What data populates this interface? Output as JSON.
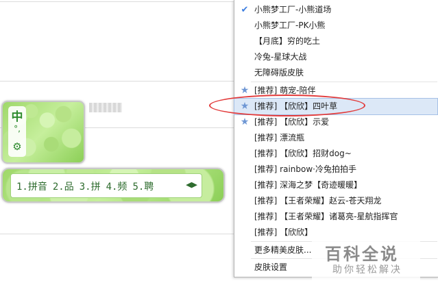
{
  "ime": {
    "mode_char": "中",
    "punct_char": "°,",
    "settings_icon": "gear-icon"
  },
  "candidates": {
    "items": [
      "1.拼音",
      "2.品",
      "3.拼",
      "4.频",
      "5.聘"
    ],
    "nav_arrows": "◀▶"
  },
  "menu": {
    "items": [
      {
        "label": "小熊梦工厂-小熊道场",
        "icon": "check-icon"
      },
      {
        "label": "小熊梦工厂-PK小熊",
        "icon": ""
      },
      {
        "label": "【月底】穷的吃土",
        "icon": ""
      },
      {
        "label": "冷兔-星球大战",
        "icon": ""
      },
      {
        "label": "无障碍版皮肤",
        "icon": ""
      },
      {
        "label": "[推荐] 萌宠-陪伴",
        "icon": "star-icon"
      },
      {
        "label": "[推荐] 【欣欣】四叶草",
        "icon": "star-icon",
        "highlighted": true
      },
      {
        "label": "[推荐] 【欣欣】示爱",
        "icon": "star-icon"
      },
      {
        "label": "[推荐] 漂流瓶",
        "icon": ""
      },
      {
        "label": "[推荐] 【欣欣】招财dog~",
        "icon": ""
      },
      {
        "label": "[推荐] rainbow·冷兔拍拍手",
        "icon": ""
      },
      {
        "label": "[推荐] 深海之梦【奇迹暖暖】",
        "icon": ""
      },
      {
        "label": "[推荐] 【王者荣耀】赵云-苍天翔龙",
        "icon": ""
      },
      {
        "label": "[推荐] 【王者荣耀】诸葛亮-星航指挥官",
        "icon": ""
      },
      {
        "label": "[推荐] 【欣欣】",
        "icon": ""
      },
      {
        "label": "更多精美皮肤...",
        "icon": ""
      },
      {
        "label": "皮肤设置",
        "icon": ""
      }
    ]
  },
  "watermark": {
    "title": "百科全说",
    "subtitle": "助你轻松解决"
  },
  "colors": {
    "highlight": "#dce8f7",
    "annotation": "#e23a3a",
    "ime_green": "#2e8b2e"
  }
}
